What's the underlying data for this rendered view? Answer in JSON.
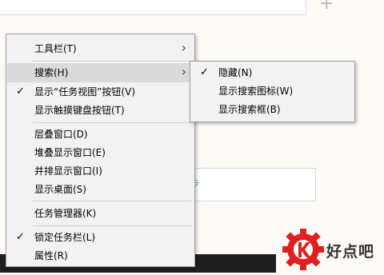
{
  "background": {
    "plus_glyph": "+",
    "green_text": "步",
    "logo_text": "好点吧"
  },
  "context_menu": {
    "toolbars": "工具栏(T)",
    "search": "搜索(H)",
    "show_task_view": "显示“任务视图”按钮(V)",
    "show_touch_keyboard": "显示触摸键盘按钮(T)",
    "cascade": "层叠窗口(D)",
    "stacked": "堆叠显示窗口(E)",
    "side_by_side": "并排显示窗口(I)",
    "show_desktop": "显示桌面(S)",
    "task_manager": "任务管理器(K)",
    "lock_taskbar": "锁定任务栏(L)",
    "properties": "属性(R)"
  },
  "search_submenu": {
    "hidden": "隐藏(N)",
    "show_search_icon": "显示搜索图标(W)",
    "show_search_box": "显示搜索框(B)"
  },
  "glyphs": {
    "check": "✓",
    "submenu_arrow": "›"
  },
  "colors": {
    "menu_bg": "#f2f2f2",
    "hover_bg": "#dadada",
    "taskbar": "#1e1e1e",
    "logo_red": "#e02020"
  }
}
